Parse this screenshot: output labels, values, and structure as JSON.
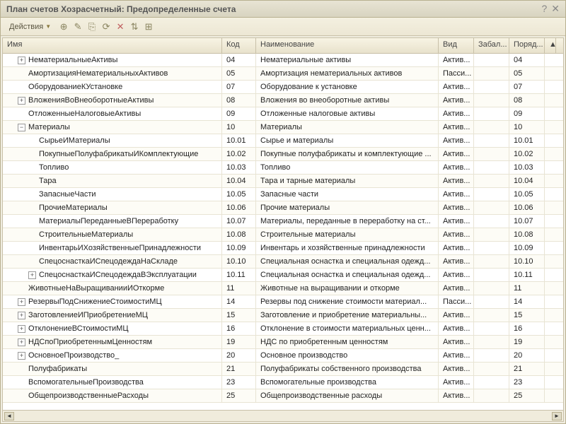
{
  "window": {
    "title": "План счетов Хозрасчетный: Предопределенные счета"
  },
  "toolbar": {
    "actions_label": "Действия"
  },
  "columns": {
    "name": "Имя",
    "code": "Код",
    "desc": "Наименование",
    "kind": "Вид",
    "zabal": "Забал...",
    "order": "Поряд..."
  },
  "rows": [
    {
      "indent": 1,
      "toggle": "+",
      "name": "НематериальныеАктивы",
      "code": "04",
      "desc": "Нематериальные активы",
      "kind": "Актив...",
      "order": "04"
    },
    {
      "indent": 1,
      "toggle": "",
      "name": "АмортизацияНематериальныхАктивов",
      "code": "05",
      "desc": "Амортизация нематериальных активов",
      "kind": "Пасси...",
      "order": "05"
    },
    {
      "indent": 1,
      "toggle": "",
      "name": "ОборудованиеКУстановке",
      "code": "07",
      "desc": "Оборудование к установке",
      "kind": "Актив...",
      "order": "07"
    },
    {
      "indent": 1,
      "toggle": "+",
      "name": "ВложенияВоВнеоборотныеАктивы",
      "code": "08",
      "desc": "Вложения во внеоборотные активы",
      "kind": "Актив...",
      "order": "08"
    },
    {
      "indent": 1,
      "toggle": "",
      "name": "ОтложенныеНалоговыеАктивы",
      "code": "09",
      "desc": "Отложенные налоговые активы",
      "kind": "Актив...",
      "order": "09"
    },
    {
      "indent": 1,
      "toggle": "-",
      "name": "Материалы",
      "code": "10",
      "desc": "Материалы",
      "kind": "Актив...",
      "order": "10"
    },
    {
      "indent": 2,
      "toggle": "",
      "name": "СырьеИМатериалы",
      "code": "10.01",
      "desc": "Сырье и материалы",
      "kind": "Актив...",
      "order": "10.01"
    },
    {
      "indent": 2,
      "toggle": "",
      "name": "ПокупныеПолуфабрикатыИКомплектующие",
      "code": "10.02",
      "desc": "Покупные полуфабрикаты и комплектующие ...",
      "kind": "Актив...",
      "order": "10.02"
    },
    {
      "indent": 2,
      "toggle": "",
      "name": "Топливо",
      "code": "10.03",
      "desc": "Топливо",
      "kind": "Актив...",
      "order": "10.03"
    },
    {
      "indent": 2,
      "toggle": "",
      "name": "Тара",
      "code": "10.04",
      "desc": "Тара и тарные материалы",
      "kind": "Актив...",
      "order": "10.04"
    },
    {
      "indent": 2,
      "toggle": "",
      "name": "ЗапасныеЧасти",
      "code": "10.05",
      "desc": "Запасные части",
      "kind": "Актив...",
      "order": "10.05"
    },
    {
      "indent": 2,
      "toggle": "",
      "name": "ПрочиеМатериалы",
      "code": "10.06",
      "desc": "Прочие материалы",
      "kind": "Актив...",
      "order": "10.06"
    },
    {
      "indent": 2,
      "toggle": "",
      "name": "МатериалыПереданныеВПереработку",
      "code": "10.07",
      "desc": "Материалы, переданные в переработку на ст...",
      "kind": "Актив...",
      "order": "10.07"
    },
    {
      "indent": 2,
      "toggle": "",
      "name": "СтроительныеМатериалы",
      "code": "10.08",
      "desc": "Строительные материалы",
      "kind": "Актив...",
      "order": "10.08"
    },
    {
      "indent": 2,
      "toggle": "",
      "name": "ИнвентарьИХозяйственныеПринадлежности",
      "code": "10.09",
      "desc": "Инвентарь и хозяйственные принадлежности",
      "kind": "Актив...",
      "order": "10.09"
    },
    {
      "indent": 2,
      "toggle": "",
      "name": "СпецоснасткаИСпецодеждаНаСкладе",
      "code": "10.10",
      "desc": "Специальная оснастка и специальная одежд...",
      "kind": "Актив...",
      "order": "10.10"
    },
    {
      "indent": 2,
      "toggle": "+",
      "name": "СпецоснасткаИСпецодеждаВЭксплуатации",
      "code": "10.11",
      "desc": "Специальная оснастка и специальная одежд...",
      "kind": "Актив...",
      "order": "10.11"
    },
    {
      "indent": 1,
      "toggle": "",
      "name": "ЖивотныеНаВыращиванииИОткорме",
      "code": "11",
      "desc": "Животные на выращивании и откорме",
      "kind": "Актив...",
      "order": "11"
    },
    {
      "indent": 1,
      "toggle": "+",
      "name": "РезервыПодСнижениеСтоимостиМЦ",
      "code": "14",
      "desc": "Резервы под снижение стоимости материал...",
      "kind": "Пасси...",
      "order": "14"
    },
    {
      "indent": 1,
      "toggle": "+",
      "name": "ЗаготовлениеИПриобретениеМЦ",
      "code": "15",
      "desc": "Заготовление и приобретение материальны...",
      "kind": "Актив...",
      "order": "15"
    },
    {
      "indent": 1,
      "toggle": "+",
      "name": "ОтклонениеВСтоимостиМЦ",
      "code": "16",
      "desc": "Отклонение в стоимости материальных ценн...",
      "kind": "Актив...",
      "order": "16"
    },
    {
      "indent": 1,
      "toggle": "+",
      "name": "НДСпоПриобретеннымЦенностям",
      "code": "19",
      "desc": "НДС по приобретенным ценностям",
      "kind": "Актив...",
      "order": "19"
    },
    {
      "indent": 1,
      "toggle": "+",
      "name": "ОсновноеПроизводство_",
      "code": "20",
      "desc": "Основное производство",
      "kind": "Актив...",
      "order": "20"
    },
    {
      "indent": 1,
      "toggle": "",
      "name": "Полуфабрикаты",
      "code": "21",
      "desc": "Полуфабрикаты собственного производства",
      "kind": "Актив...",
      "order": "21"
    },
    {
      "indent": 1,
      "toggle": "",
      "name": "ВспомогательныеПроизводства",
      "code": "23",
      "desc": "Вспомогательные производства",
      "kind": "Актив...",
      "order": "23"
    },
    {
      "indent": 1,
      "toggle": "",
      "name": "ОбщепроизводственныеРасходы",
      "code": "25",
      "desc": "Общепроизводственные расходы",
      "kind": "Актив...",
      "order": "25"
    }
  ]
}
